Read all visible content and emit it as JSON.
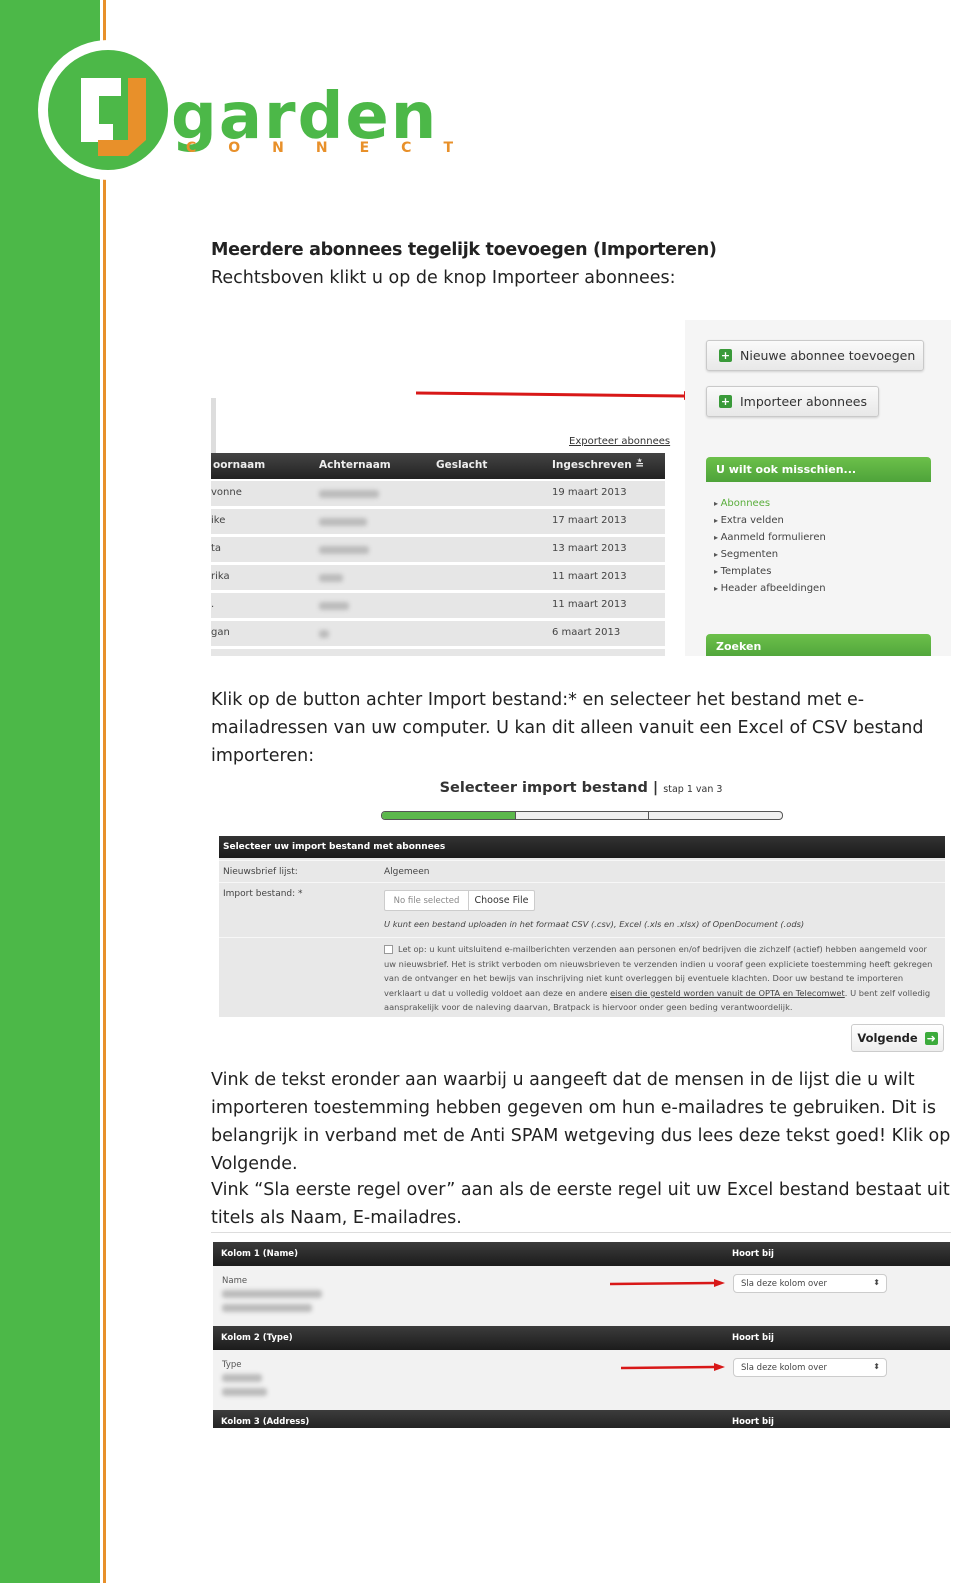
{
  "logo": {
    "brand": "GARDEN",
    "sub": "CONNECT",
    "colors": {
      "green": "#4cb848",
      "orange": "#e8902a"
    }
  },
  "section_title": "Meerdere abonnees tegelijk toevoegen (Importeren)",
  "para1": "Rechtsboven klikt u op de knop Importeer abonnees:",
  "shot1": {
    "buttons": {
      "new": "Nieuwe abonnee toevoegen",
      "import": "Importeer abonnees"
    },
    "export_link": "Exporteer abonnees",
    "columns": [
      "oornaam",
      "Achternaam",
      "Geslacht",
      "Ingeschreven ≛"
    ],
    "rows": [
      {
        "first": "vonne",
        "date": "19 maart 2013"
      },
      {
        "first": "ike",
        "date": "17 maart 2013"
      },
      {
        "first": "ta",
        "date": "13 maart 2013"
      },
      {
        "first": "rika",
        "date": "11 maart 2013"
      },
      {
        "first": ".",
        "date": "11 maart 2013"
      },
      {
        "first": "gan",
        "date": "6 maart 2013"
      }
    ],
    "sidebar": {
      "header": "U wilt ook misschien...",
      "links": [
        "Abonnees",
        "Extra velden",
        "Aanmeld formulieren",
        "Segmenten",
        "Templates",
        "Header afbeeldingen"
      ],
      "search_header": "Zoeken"
    }
  },
  "para2": "Klik op de button achter Import bestand:* en selecteer het bestand met e-mailadressen van uw computer. U kan dit alleen vanuit een Excel of CSV bestand importeren:",
  "shot2": {
    "title": "Selecteer import bestand",
    "step": "stap 1 van 3",
    "progress_fraction": 0.333,
    "form_header": "Selecteer uw import bestand met abonnees",
    "newsletter_label": "Nieuwsbrief lijst:",
    "newsletter_value": "Algemeen",
    "file_label": "Import bestand: *",
    "file_status": "No file selected",
    "choose_file": "Choose File",
    "hint": "U kunt een bestand uploaden in het formaat CSV (.csv), Excel (.xls en .xlsx) of OpenDocument (.ods)",
    "legal_1": "Let op: u kunt uitsluitend e-mailberichten verzenden aan personen en/of bedrijven die zichzelf (actief) hebben aangemeld voor uw nieuwsbrief. Het is strikt verboden om nieuwsbrieven te verzenden indien u vooraf geen expliciete toestemming heeft gekregen van de ontvanger en het bewijs van inschrijving niet kunt overleggen bij eventuele klachten. Door uw bestand te importeren verklaart u dat u volledig voldoet aan deze en andere ",
    "legal_link": "eisen die gesteld worden vanuit de OPTA en Telecomwet",
    "legal_2": ". U bent zelf volledig aansprakelijk voor de naleving daarvan, Bratpack is hiervoor onder geen beding verantwoordelijk.",
    "next": "Volgende"
  },
  "para3": "Vink de tekst eronder aan waarbij u aangeeft dat de mensen in de lijst die u wilt importeren toestemming hebben gegeven om hun e-mailadres te gebruiken. Dit is belangrijk in verband met de Anti SPAM wetgeving dus lees deze tekst goed! Klik op Volgende.",
  "para4": "Vink “Sla eerste regel over” aan als de eerste regel uit uw Excel bestand bestaat uit titels als Naam, E-mailadres.",
  "shot3": {
    "belongs": "Hoort bij",
    "columns": [
      {
        "header": "Kolom 1 (Name)",
        "field": "Name",
        "select": "Sla deze kolom over"
      },
      {
        "header": "Kolom 2 (Type)",
        "field": "Type",
        "select": "Sla deze kolom over"
      },
      {
        "header": "Kolom 3 (Address)"
      }
    ]
  }
}
